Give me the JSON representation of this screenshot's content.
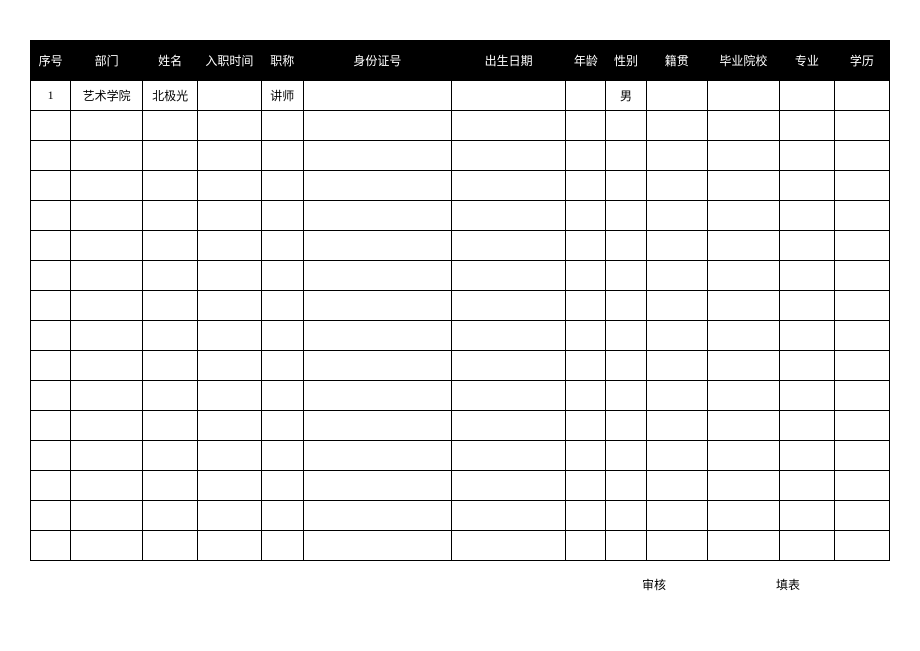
{
  "headers": {
    "seq": "序号",
    "dept": "部门",
    "name": "姓名",
    "hire": "入职时间",
    "title": "职称",
    "id": "身份证号",
    "birth": "出生日期",
    "age": "年龄",
    "gender": "性别",
    "origin": "籍贯",
    "school": "毕业院校",
    "major": "专业",
    "edu": "学历"
  },
  "rows": [
    {
      "seq": "1",
      "dept": "艺术学院",
      "name": "北极光",
      "hire": "",
      "title": "讲师",
      "id": "",
      "birth": "",
      "age": "",
      "gender": "男",
      "origin": "",
      "school": "",
      "major": "",
      "edu": ""
    },
    {
      "seq": "",
      "dept": "",
      "name": "",
      "hire": "",
      "title": "",
      "id": "",
      "birth": "",
      "age": "",
      "gender": "",
      "origin": "",
      "school": "",
      "major": "",
      "edu": ""
    },
    {
      "seq": "",
      "dept": "",
      "name": "",
      "hire": "",
      "title": "",
      "id": "",
      "birth": "",
      "age": "",
      "gender": "",
      "origin": "",
      "school": "",
      "major": "",
      "edu": ""
    },
    {
      "seq": "",
      "dept": "",
      "name": "",
      "hire": "",
      "title": "",
      "id": "",
      "birth": "",
      "age": "",
      "gender": "",
      "origin": "",
      "school": "",
      "major": "",
      "edu": ""
    },
    {
      "seq": "",
      "dept": "",
      "name": "",
      "hire": "",
      "title": "",
      "id": "",
      "birth": "",
      "age": "",
      "gender": "",
      "origin": "",
      "school": "",
      "major": "",
      "edu": ""
    },
    {
      "seq": "",
      "dept": "",
      "name": "",
      "hire": "",
      "title": "",
      "id": "",
      "birth": "",
      "age": "",
      "gender": "",
      "origin": "",
      "school": "",
      "major": "",
      "edu": ""
    },
    {
      "seq": "",
      "dept": "",
      "name": "",
      "hire": "",
      "title": "",
      "id": "",
      "birth": "",
      "age": "",
      "gender": "",
      "origin": "",
      "school": "",
      "major": "",
      "edu": ""
    },
    {
      "seq": "",
      "dept": "",
      "name": "",
      "hire": "",
      "title": "",
      "id": "",
      "birth": "",
      "age": "",
      "gender": "",
      "origin": "",
      "school": "",
      "major": "",
      "edu": ""
    },
    {
      "seq": "",
      "dept": "",
      "name": "",
      "hire": "",
      "title": "",
      "id": "",
      "birth": "",
      "age": "",
      "gender": "",
      "origin": "",
      "school": "",
      "major": "",
      "edu": ""
    },
    {
      "seq": "",
      "dept": "",
      "name": "",
      "hire": "",
      "title": "",
      "id": "",
      "birth": "",
      "age": "",
      "gender": "",
      "origin": "",
      "school": "",
      "major": "",
      "edu": ""
    },
    {
      "seq": "",
      "dept": "",
      "name": "",
      "hire": "",
      "title": "",
      "id": "",
      "birth": "",
      "age": "",
      "gender": "",
      "origin": "",
      "school": "",
      "major": "",
      "edu": ""
    },
    {
      "seq": "",
      "dept": "",
      "name": "",
      "hire": "",
      "title": "",
      "id": "",
      "birth": "",
      "age": "",
      "gender": "",
      "origin": "",
      "school": "",
      "major": "",
      "edu": ""
    },
    {
      "seq": "",
      "dept": "",
      "name": "",
      "hire": "",
      "title": "",
      "id": "",
      "birth": "",
      "age": "",
      "gender": "",
      "origin": "",
      "school": "",
      "major": "",
      "edu": ""
    },
    {
      "seq": "",
      "dept": "",
      "name": "",
      "hire": "",
      "title": "",
      "id": "",
      "birth": "",
      "age": "",
      "gender": "",
      "origin": "",
      "school": "",
      "major": "",
      "edu": ""
    },
    {
      "seq": "",
      "dept": "",
      "name": "",
      "hire": "",
      "title": "",
      "id": "",
      "birth": "",
      "age": "",
      "gender": "",
      "origin": "",
      "school": "",
      "major": "",
      "edu": ""
    },
    {
      "seq": "",
      "dept": "",
      "name": "",
      "hire": "",
      "title": "",
      "id": "",
      "birth": "",
      "age": "",
      "gender": "",
      "origin": "",
      "school": "",
      "major": "",
      "edu": ""
    }
  ],
  "footer": {
    "review": "审核",
    "fill": "填表"
  }
}
